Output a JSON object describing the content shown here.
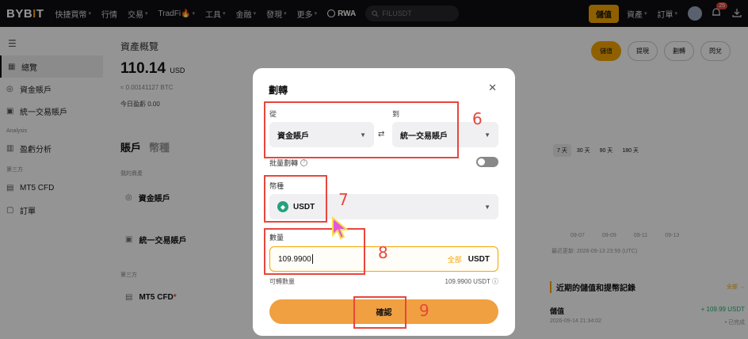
{
  "nav": {
    "logo_a": "BYB",
    "logo_i": "I",
    "logo_b": "T",
    "items": [
      "快捷買幣",
      "行情",
      "交易",
      "TradFi🔥",
      "工具",
      "金融",
      "發現",
      "更多"
    ],
    "rwa": "RWA",
    "search_placeholder": "FILUSDT",
    "deposit": "儲值",
    "assets": "資產",
    "orders": "訂單",
    "notif_count": "25"
  },
  "sidebar": {
    "items": [
      {
        "label": "總覽",
        "icon": "grid-icon"
      },
      {
        "label": "資金賬戶",
        "icon": "circle-icon"
      },
      {
        "label": "統一交易賬戶",
        "icon": "card-icon"
      }
    ],
    "section_analysis": "Analysis",
    "analysis_item": "盈虧分析",
    "section_third": "第三方",
    "mt5": "MT5 CFD",
    "orders": "訂單"
  },
  "main": {
    "title": "資產概覽",
    "balance": "110.14",
    "balance_cur": "USD",
    "btc": "≈ 0.00141127 BTC",
    "pnl": "今日盈虧 0.00",
    "tab_accounts": "賬戶",
    "tab_coins": "幣種",
    "my_assets": "我的資產",
    "acct_funding": "資金賬戶",
    "acct_unified": "統一交易賬戶",
    "third_party": "第三方",
    "acct_mt5": "MT5 CFD",
    "btn_deposit": "儲值",
    "btn_withdraw": "提現",
    "btn_transfer": "劃轉",
    "btn_convert": "閃兌",
    "ranges": [
      "7 天",
      "30 天",
      "90 天",
      "180 天"
    ],
    "xaxis": [
      "09-07",
      "09-09",
      "09-11",
      "09-13"
    ],
    "updated": "最近更新: 2026-09-13 23:59 (UTC)",
    "recent_title": "近期的儲值和提幣記錄",
    "recent_all": "全部",
    "rec_type": "儲值",
    "rec_amt": "+ 109.99 USDT",
    "rec_time": "2026-09-14 21:34:02",
    "rec_status": "• 已完成"
  },
  "modal": {
    "title": "劃轉",
    "from_label": "從",
    "to_label": "到",
    "from_value": "資金賬戶",
    "to_value": "統一交易賬戶",
    "batch": "批量劃轉",
    "coin_label": "幣種",
    "coin_value": "USDT",
    "amount_label": "數量",
    "amount_value": "109.9900",
    "all": "全部",
    "unit": "USDT",
    "avail_label": "可轉數量",
    "avail_value": "109.9900 USDT",
    "confirm": "確認"
  },
  "annotations": [
    "6",
    "7",
    "8",
    "9"
  ]
}
